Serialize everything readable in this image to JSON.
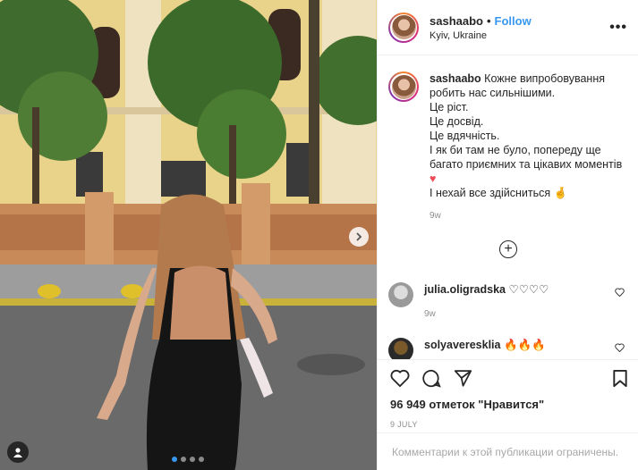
{
  "post": {
    "username": "sashaabo",
    "separator": "•",
    "follow_label": "Follow",
    "location": "Kyiv, Ukraine",
    "more_label": "•••"
  },
  "caption": {
    "username": "sashaabo",
    "lines": [
      "Кожне випробовування робить нас сильнішими.",
      "Це ріст.",
      "Це досвід.",
      "Це вдячність.",
      "І як би там не було, попереду ще багато приємних та цікавих моментів",
      "І нехай все здійсниться"
    ],
    "heart_emoji": "♥",
    "hand_emoji": "🤞",
    "time": "9w"
  },
  "load_more": {
    "icon": "plus-circle-icon",
    "label": "+"
  },
  "comments": [
    {
      "username": "julia.oligradska",
      "text": "♡♡♡♡",
      "time": "9w"
    },
    {
      "username": "solyaveresklia",
      "text": "🔥🔥🔥",
      "time": ""
    }
  ],
  "actions": {
    "likes": "96 949 отметок \"Нравится\"",
    "date": "9 JULY",
    "comments_restricted": "Комментарии к этой публикации ограничены."
  },
  "colors": {
    "accent": "#3897f0",
    "heart": "#ed4956",
    "muted": "#8e8e8e"
  }
}
